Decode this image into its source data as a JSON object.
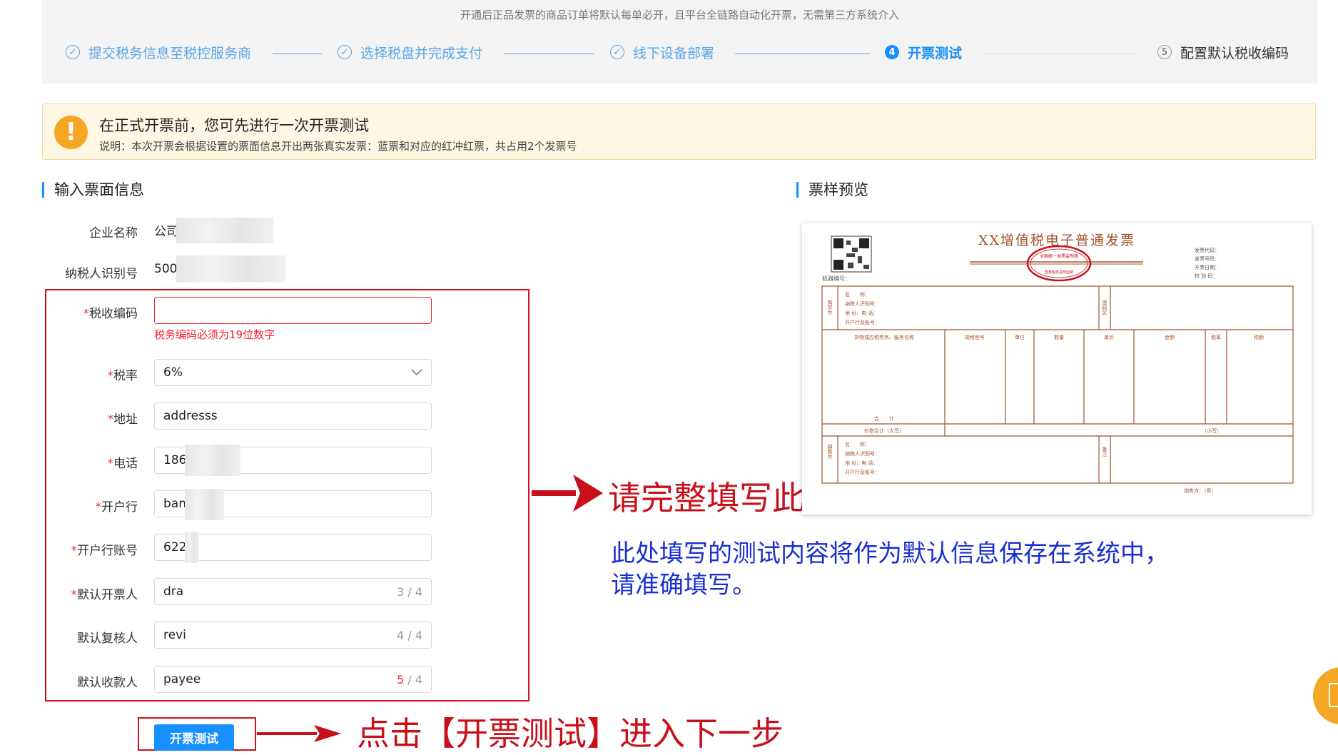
{
  "header": {
    "notice": "开通后正品发票的商品订单将默认每单必开，且平台全链路自动化开票，无需第三方系统介入",
    "steps": [
      {
        "icon": "✓",
        "label": "提交税务信息至税控服务商",
        "state": "done"
      },
      {
        "icon": "✓",
        "label": "选择税盘并完成支付",
        "state": "done"
      },
      {
        "icon": "✓",
        "label": "线下设备部署",
        "state": "done"
      },
      {
        "icon": "4",
        "label": "开票测试",
        "state": "active"
      },
      {
        "icon": "5",
        "label": "配置默认税收编码",
        "state": "todo"
      }
    ]
  },
  "alert": {
    "icon": "!",
    "title": "在正式开票前，您可先进行一次开票测试",
    "desc": "说明：本次开票会根据设置的票面信息开出两张真实发票：蓝票和对应的红冲红票，共占用2个发票号"
  },
  "form": {
    "section_title": "输入票面信息",
    "company_label": "企业名称",
    "company_value": "公司",
    "taxpayer_label": "纳税人识别号",
    "taxpayer_value": "500",
    "tax_code_label": "税收编码",
    "tax_code_value": "",
    "tax_code_error": "税务编码必须为19位数字",
    "tax_rate_label": "税率",
    "tax_rate_value": "6%",
    "address_label": "地址",
    "address_value": "addresss",
    "phone_label": "电话",
    "phone_value": "186",
    "bank_label": "开户行",
    "bank_value": "ban",
    "account_label": "开户行账号",
    "account_value": "622",
    "drawer_label": "默认开票人",
    "drawer_value": "dra",
    "drawer_count": "3",
    "reviewer_label": "默认复核人",
    "reviewer_value": "revi",
    "reviewer_count": "4",
    "payee_label": "默认收款人",
    "payee_value": "payee",
    "payee_count": "5",
    "max_count": " / 4",
    "req_mark": "*",
    "submit_label": "开票测试"
  },
  "preview": {
    "section_title": "票样预览",
    "invoice_title": "XX增值税电子普通发票",
    "machine_no_label": "机器编号：",
    "right_meta": [
      "发票代码：",
      "发票号码：",
      "开票日期：",
      "校 验 码："
    ],
    "buyer_side": "购买方",
    "buyer_fields": [
      "名　　称：",
      "纳税人识别号：",
      "地 址、电 话：",
      "开户行及账号："
    ],
    "password_side": "密码区",
    "item_headers": [
      "货物或应税劳务、服务名称",
      "规格型号",
      "单位",
      "数量",
      "单价",
      "金额",
      "税率",
      "税额"
    ],
    "total_label": "合　　计",
    "price_tax_label": "价税合计（大写）",
    "small_label": "（小写）",
    "seller_side": "销售方",
    "seller_fields": [
      "名　　称：",
      "纳税人识别号：",
      "地 址、电 话：",
      "开户行及账号："
    ],
    "remark_side": "备注",
    "footer": "销售方：（章）",
    "stamp_top": "全国统一发票监制章",
    "stamp_mid": "国家税务总局监制"
  },
  "annotations": {
    "fill_hint": "请完整填写此处各相应字段信息",
    "save_hint_line1": "此处填写的测试内容将作为默认信息保存在系统中，",
    "save_hint_line2": "请准确填写。",
    "click_hint": "点击【开票测试】进入下一步"
  },
  "colors": {
    "primary": "#1890ff",
    "annotation_red": "#c8101b",
    "annotation_blue": "#1a2fcf",
    "warning": "#f5a623",
    "invoice_brown": "#a0522d"
  }
}
